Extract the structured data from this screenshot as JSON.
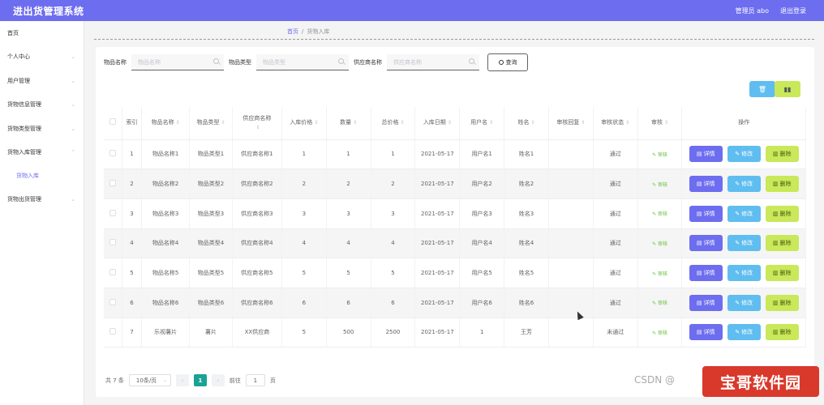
{
  "header": {
    "title": "进出货管理系统",
    "user": "管理员 abo",
    "logout": "退出登录"
  },
  "sidebar": {
    "items": [
      {
        "label": "首页",
        "chevron": false
      },
      {
        "label": "个人中心",
        "chevron": true
      },
      {
        "label": "用户管理",
        "chevron": true
      },
      {
        "label": "货物信息管理",
        "chevron": true
      },
      {
        "label": "货物类型管理",
        "chevron": true
      },
      {
        "label": "货物入库管理",
        "chevron": true
      },
      {
        "label": "货物入库",
        "sub": true
      },
      {
        "label": "货物出货管理",
        "chevron": true
      }
    ]
  },
  "breadcrumb": {
    "home": "首页",
    "current": "货物入库"
  },
  "filters": {
    "name_label": "物品名称",
    "name_placeholder": "物品名称",
    "type_label": "物品类型",
    "type_placeholder": "物品类型",
    "supplier_label": "供应商名称",
    "supplier_placeholder": "供应商名称",
    "search_label": "查询"
  },
  "table": {
    "headers": [
      "索引",
      "物品名称",
      "物品类型",
      "供应商名称",
      "入库价格",
      "数量",
      "总价格",
      "入库日期",
      "用户名",
      "姓名",
      "审核回复",
      "审核状态",
      "审核",
      "操作"
    ],
    "rows": [
      [
        "1",
        "物品名称1",
        "物品类型1",
        "供应商名称1",
        "1",
        "1",
        "1",
        "2021-05-17",
        "用户名1",
        "姓名1",
        "",
        "通过"
      ],
      [
        "2",
        "物品名称2",
        "物品类型2",
        "供应商名称2",
        "2",
        "2",
        "2",
        "2021-05-17",
        "用户名2",
        "姓名2",
        "",
        "通过"
      ],
      [
        "3",
        "物品名称3",
        "物品类型3",
        "供应商名称3",
        "3",
        "3",
        "3",
        "2021-05-17",
        "用户名3",
        "姓名3",
        "",
        "通过"
      ],
      [
        "4",
        "物品名称4",
        "物品类型4",
        "供应商名称4",
        "4",
        "4",
        "4",
        "2021-05-17",
        "用户名4",
        "姓名4",
        "",
        "通过"
      ],
      [
        "5",
        "物品名称5",
        "物品类型5",
        "供应商名称5",
        "5",
        "5",
        "5",
        "2021-05-17",
        "用户名5",
        "姓名5",
        "",
        "通过"
      ],
      [
        "6",
        "物品名称6",
        "物品类型6",
        "供应商名称6",
        "6",
        "6",
        "6",
        "2021-05-17",
        "用户名6",
        "姓名6",
        "",
        "通过"
      ],
      [
        "7",
        "乐视薯片",
        "薯片",
        "XX供应商",
        "5",
        "500",
        "2500",
        "2021-05-17",
        "1",
        "王芳",
        "",
        "未通过"
      ]
    ],
    "audit_link": "审核",
    "detail_label": "详情",
    "edit_label": "修改",
    "delete_label": "删除"
  },
  "pagination": {
    "total": "共 7 条",
    "page_size": "10条/页",
    "current_page": "1",
    "goto_prefix": "前往",
    "goto_value": "1",
    "goto_suffix": "页"
  },
  "watermark": {
    "csdn": "CSDN @",
    "logo": "宝哥软件园"
  },
  "colors": {
    "primary": "#6d6df0",
    "info": "#5fbdf0",
    "lime": "#c9e85a",
    "teal": "#1aa394"
  }
}
